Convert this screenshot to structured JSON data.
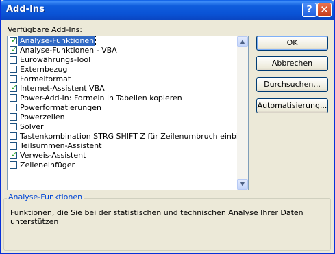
{
  "window": {
    "title": "Add-Ins",
    "help_glyph": "?",
    "close_glyph": "✕"
  },
  "list_label": "Verfügbare Add-Ins:",
  "addins": [
    {
      "label": "Analyse-Funktionen",
      "checked": true,
      "selected": true
    },
    {
      "label": "Analyse-Funktionen - VBA",
      "checked": true,
      "selected": false
    },
    {
      "label": "Eurowährungs-Tool",
      "checked": false,
      "selected": false
    },
    {
      "label": "Externbezug",
      "checked": false,
      "selected": false
    },
    {
      "label": "Formelformat",
      "checked": false,
      "selected": false
    },
    {
      "label": "Internet-Assistent VBA",
      "checked": true,
      "selected": false
    },
    {
      "label": "Power-Add-In: Formeln in Tabellen kopieren",
      "checked": false,
      "selected": false
    },
    {
      "label": "Powerformatierungen",
      "checked": false,
      "selected": false
    },
    {
      "label": "Powerzellen",
      "checked": false,
      "selected": false
    },
    {
      "label": "Solver",
      "checked": false,
      "selected": false
    },
    {
      "label": "Tastenkombination STRG SHIFT Z für Zeilenumbruch einbinden",
      "checked": false,
      "selected": false
    },
    {
      "label": "Teilsummen-Assistent",
      "checked": false,
      "selected": false
    },
    {
      "label": "Verweis-Assistent",
      "checked": true,
      "selected": false
    },
    {
      "label": "Zelleneinfüger",
      "checked": false,
      "selected": false
    }
  ],
  "buttons": {
    "ok": "OK",
    "cancel": "Abbrechen",
    "browse": "Durchsuchen...",
    "automation": "Automatisierung..."
  },
  "description": {
    "title": "Analyse-Funktionen",
    "text": "Funktionen, die Sie bei der statistischen und technischen Analyse Ihrer Daten unterstützen"
  },
  "icons": {
    "check": "check-icon",
    "scroll_up": "arrow-up-icon",
    "scroll_down": "arrow-down-icon"
  }
}
